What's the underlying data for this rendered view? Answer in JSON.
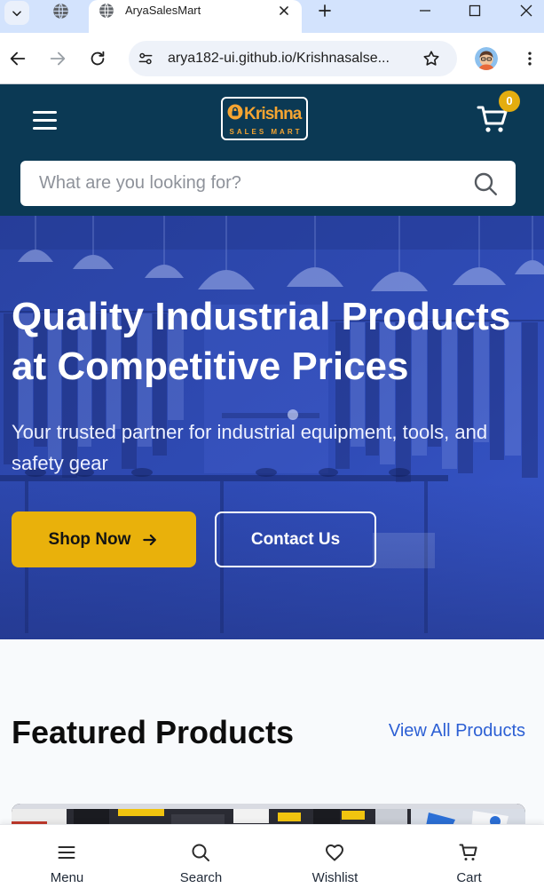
{
  "browser": {
    "tabs": [
      {
        "icon": "globe-icon",
        "active": false
      },
      {
        "title": "AryaSalesMart",
        "icon": "globe-icon",
        "active": true
      }
    ],
    "url": "arya182-ui.github.io/Krishnasalse...",
    "toolbar_icons": [
      "back-arrow-icon",
      "forward-arrow-icon",
      "reload-icon",
      "site-info-icon",
      "bookmark-star-icon",
      "profile-avatar",
      "kebab-menu-icon"
    ],
    "window_controls": [
      "minimize-icon",
      "maximize-icon",
      "close-icon"
    ]
  },
  "header": {
    "logo": {
      "name": "Krishna",
      "tagline": "SALES MART",
      "icon": "lock-icon"
    },
    "cart_count": "0"
  },
  "search": {
    "placeholder": "What are you looking for?"
  },
  "hero": {
    "title": "Quality Industrial Products at Competitive Prices",
    "subtitle": "Your trusted partner for industrial equipment, tools, and safety gear",
    "primary_cta": "Shop Now",
    "secondary_cta": "Contact Us"
  },
  "featured": {
    "title": "Featured Products",
    "view_all": "View All Products"
  },
  "bottom_nav": [
    {
      "label": "Menu",
      "icon": "menu-icon"
    },
    {
      "label": "Search",
      "icon": "search-icon"
    },
    {
      "label": "Wishlist",
      "icon": "heart-icon"
    },
    {
      "label": "Cart",
      "icon": "cart-icon"
    }
  ],
  "colors": {
    "header_bg": "#0b3954",
    "logo_orange": "#f6a531",
    "accent": "#e9b10b",
    "cart_badge": "#e4ad0f",
    "hero_overlay": "#2d48ad",
    "link": "#2c5fd4",
    "section_bg": "#f8fafc"
  }
}
